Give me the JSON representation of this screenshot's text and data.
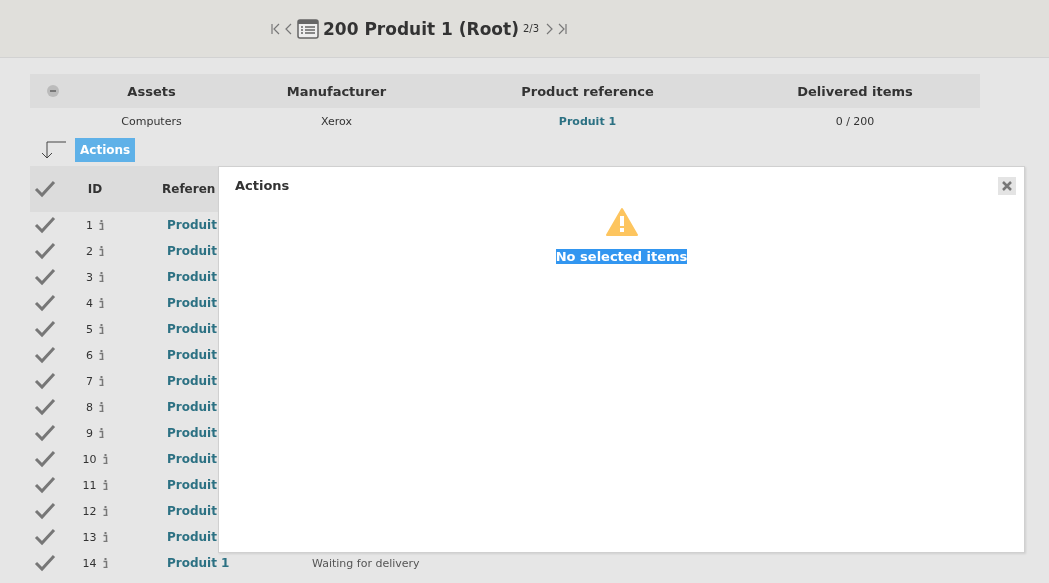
{
  "header": {
    "title": "200 Produit 1 (Root)",
    "position": "2/3"
  },
  "summary": {
    "columns": [
      "Assets",
      "Manufacturer",
      "Product reference",
      "Delivered items"
    ],
    "row": [
      "Computers",
      "Xerox",
      "Produit 1",
      "0 / 200"
    ]
  },
  "actions_button": "Actions",
  "items": {
    "columns": [
      "ID",
      "Referen"
    ],
    "rows": [
      {
        "id": "1",
        "reference": "Produit"
      },
      {
        "id": "2",
        "reference": "Produit"
      },
      {
        "id": "3",
        "reference": "Produit"
      },
      {
        "id": "4",
        "reference": "Produit"
      },
      {
        "id": "5",
        "reference": "Produit"
      },
      {
        "id": "6",
        "reference": "Produit"
      },
      {
        "id": "7",
        "reference": "Produit"
      },
      {
        "id": "8",
        "reference": "Produit"
      },
      {
        "id": "9",
        "reference": "Produit"
      },
      {
        "id": "10",
        "reference": "Produit"
      },
      {
        "id": "11",
        "reference": "Produit"
      },
      {
        "id": "12",
        "reference": "Produit"
      },
      {
        "id": "13",
        "reference": "Produit"
      },
      {
        "id": "14",
        "reference": "Produit 1",
        "status": "Waiting for delivery"
      }
    ]
  },
  "dialog": {
    "title": "Actions",
    "message": "No selected items"
  }
}
